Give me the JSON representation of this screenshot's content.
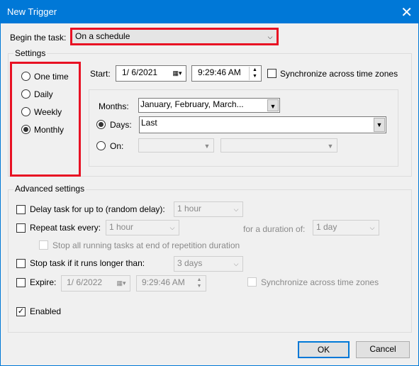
{
  "window": {
    "title": "New Trigger",
    "close_icon": "close-icon"
  },
  "begin": {
    "label": "Begin the task:",
    "value": "On a schedule"
  },
  "settings": {
    "label": "Settings",
    "radios": [
      {
        "label": "One time",
        "checked": false
      },
      {
        "label": "Daily",
        "checked": false
      },
      {
        "label": "Weekly",
        "checked": false
      },
      {
        "label": "Monthly",
        "checked": true
      }
    ],
    "start_label": "Start:",
    "start_date": "1/ 6/2021",
    "start_time": "9:29:46 AM",
    "sync_label": "Synchronize across time zones",
    "months_label": "Months:",
    "months_value": "January, February, March...",
    "days_label": "Days:",
    "days_value": "Last",
    "on_label": "On:"
  },
  "advanced": {
    "label": "Advanced settings",
    "delay_label": "Delay task for up to (random delay):",
    "delay_value": "1 hour",
    "repeat_label": "Repeat task every:",
    "repeat_value": "1 hour",
    "duration_label": "for a duration of:",
    "duration_value": "1 day",
    "stop_all_label": "Stop all running tasks at end of repetition duration",
    "stop_label": "Stop task if it runs longer than:",
    "stop_value": "3 days",
    "expire_label": "Expire:",
    "expire_date": "1/ 6/2022",
    "expire_time": "9:29:46 AM",
    "expire_sync_label": "Synchronize across time zones",
    "enabled_label": "Enabled",
    "enabled": true
  },
  "buttons": {
    "ok": "OK",
    "cancel": "Cancel"
  },
  "colors": {
    "title_bar": "#0078d7",
    "highlight": "#e81123"
  }
}
